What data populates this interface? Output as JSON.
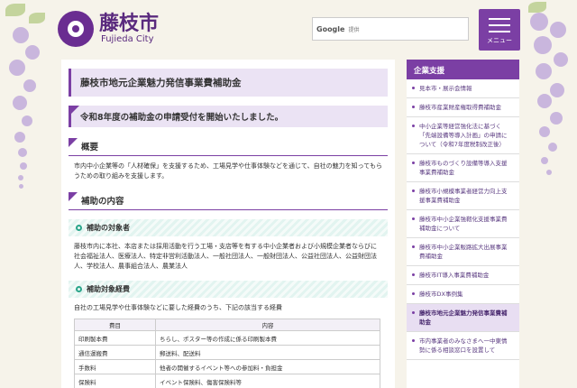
{
  "header": {
    "logo_jp": "藤枝市",
    "logo_en": "Fujieda City",
    "search_brand": "Google",
    "search_hint": "提供",
    "menu_label": "メニュー"
  },
  "main": {
    "title": "藤枝市地元企業魅力発信事業費補助金",
    "notice": "令和8年度の補助金の申請受付を開始いたしました。",
    "overview_heading": "概要",
    "overview_text": "市内中小企業等の「人材確保」を支援するため、工場見学や仕事体験などを通じて、自社の魅力を知ってもらうための取り組みを支援します。",
    "content_heading": "補助の内容",
    "target_heading": "補助の対象者",
    "target_text": "藤枝市内に本社、本店または採用活動を行う工場・支店等を有する中小企業者および小規模企業者ならびに社会福祉法人、医療法人、特定非営利活動法人、一般社団法人、一般財団法人、公益社団法人、公益財団法人、学校法人、農事組合法人、農業法人",
    "expense_heading": "補助対象経費",
    "expense_text": "自社の工場見学や仕事体験などに要した経費のうち、下記の該当する経費",
    "table": {
      "headers": [
        "費目",
        "内容"
      ],
      "rows": [
        [
          "印刷製本費",
          "ちらし、ポスター等の作成に係る印刷製本費"
        ],
        [
          "通信運搬費",
          "郵送料、配送料"
        ],
        [
          "手数料",
          "他者の開催するイベント等への参加料・負担金"
        ],
        [
          "保険料",
          "イベント保険料、傷害保険料等"
        ]
      ]
    }
  },
  "sidebar": {
    "heading": "企業支援",
    "items": [
      "見本市・展示会情報",
      "藤枝市産業財産権取得費補助金",
      "中小企業等経営強化法に基づく「先端設備等導入計画」の申請について（令和7年度税制改正後）",
      "藤枝市ものづくり設備等導入支援事業費補助金",
      "藤枝市小規模事業者経営力向上支援事業費補助金",
      "藤枝市中小企業強靭化支援事業費補助金について",
      "藤枝市中小企業販路拡大出展事業費補助金",
      "藤枝市IT導入事業費補助金",
      "藤枝市DX事例集",
      "藤枝市地元企業魅力発信事業費補助金",
      "市内事業者のみなさまへ一中東情勢に係る相談窓口を設置して"
    ],
    "active_index": 9
  }
}
